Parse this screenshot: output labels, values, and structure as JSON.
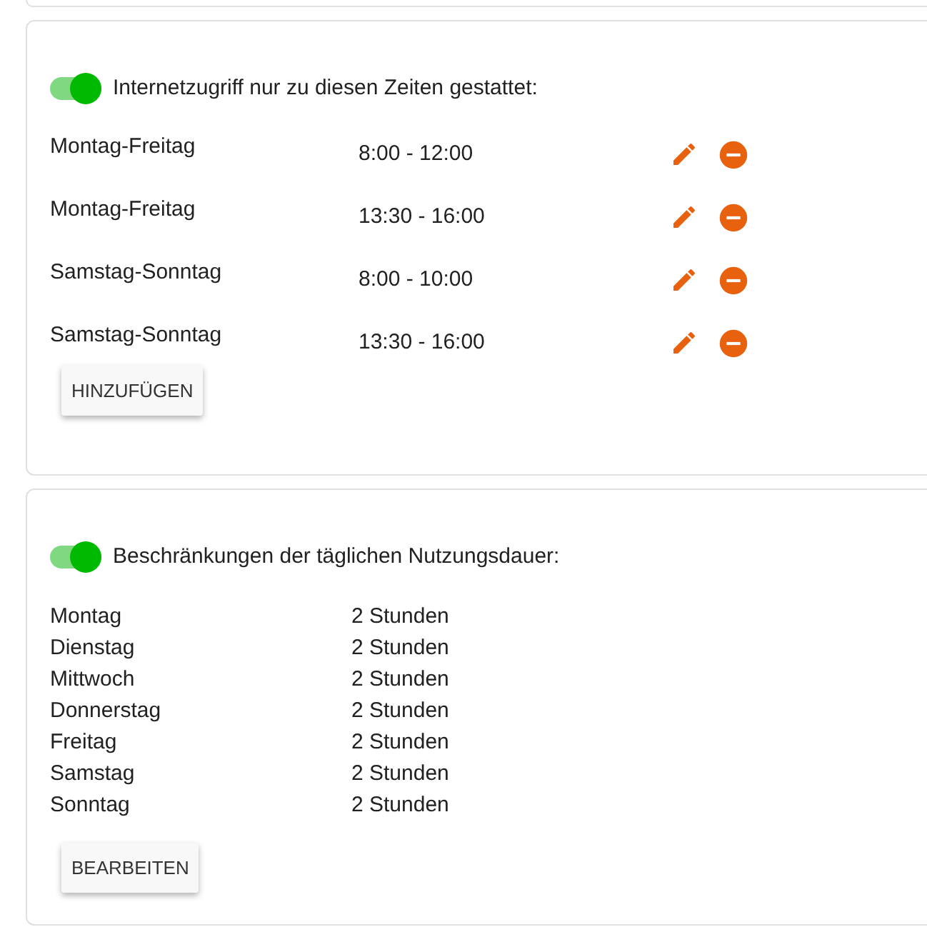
{
  "time_windows": {
    "enabled": true,
    "label": "Internetzugriff nur zu diesen Zeiten gestattet:",
    "rows": [
      {
        "days": "Montag-Freitag",
        "time": "8:00 - 12:00"
      },
      {
        "days": "Montag-Freitag",
        "time": "13:30 - 16:00"
      },
      {
        "days": "Samstag-Sonntag",
        "time": "8:00 - 10:00"
      },
      {
        "days": "Samstag-Sonntag",
        "time": "13:30 - 16:00"
      }
    ],
    "button": "HINZUFÜGEN"
  },
  "daily_limits": {
    "enabled": true,
    "label": "Beschränkungen der täglichen Nutzungsdauer:",
    "rows": [
      {
        "day": "Montag",
        "limit": "2 Stunden"
      },
      {
        "day": "Dienstag",
        "limit": "2 Stunden"
      },
      {
        "day": "Mittwoch",
        "limit": "2 Stunden"
      },
      {
        "day": "Donnerstag",
        "limit": "2 Stunden"
      },
      {
        "day": "Freitag",
        "limit": "2 Stunden"
      },
      {
        "day": "Samstag",
        "limit": "2 Stunden"
      },
      {
        "day": "Sonntag",
        "limit": "2 Stunden"
      }
    ],
    "button": "BEARBEITEN"
  }
}
